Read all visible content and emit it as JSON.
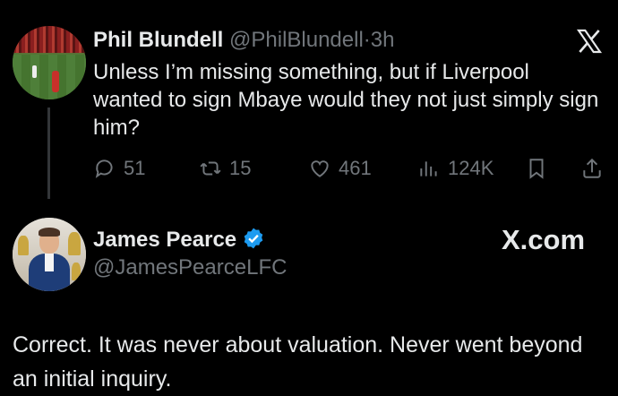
{
  "tweet1": {
    "name": "Phil Blundell",
    "handle": "@PhilBlundell",
    "separator": "·",
    "time": "3h",
    "text": "Unless I’m missing something, but if Liverpool wanted to sign Mbaye would they not just simply sign him?",
    "replies": "51",
    "retweets": "15",
    "likes": "461",
    "views": "124K"
  },
  "tweet2": {
    "name": "James Pearce",
    "handle": "@JamesPearceLFC",
    "text": "Correct. It was never about valuation. Never went beyond an initial inquiry."
  },
  "watermark": "X.com",
  "colors": {
    "background": "#000000",
    "text": "#e7e9ea",
    "muted": "#71767b",
    "verified": "#1d9bf0"
  },
  "icons": [
    "x-logo-icon",
    "reply-icon",
    "retweet-icon",
    "like-icon",
    "views-icon",
    "bookmark-icon",
    "share-icon",
    "verified-badge-icon"
  ]
}
